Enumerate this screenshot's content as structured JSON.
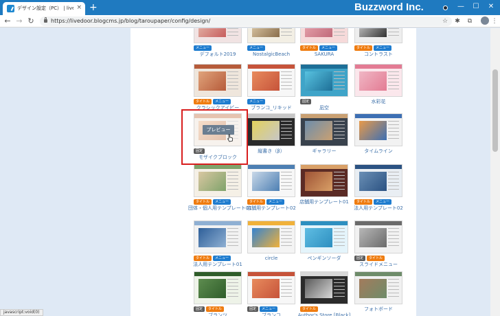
{
  "browser": {
    "tab_title": "デザイン設定（PC） | livedoor Blog",
    "tab_close": "×",
    "new_tab": "+",
    "brand": "Buzzword Inc.",
    "url": "https://livedoor.blogcms.jp/blog/taroupaper/config/design/",
    "status": "javascript:void(0)"
  },
  "icons": {
    "back": "←",
    "forward": "→",
    "reload": "↻",
    "star": "☆",
    "extension": "✱",
    "puzzle": "⧉",
    "menu": "⋮",
    "minimize": "—",
    "maximize": "☐",
    "close": "✕"
  },
  "badges": {
    "menu": "メニュー",
    "title": "タイトル",
    "fixed": "固定"
  },
  "preview_label": "プレビュー",
  "themes": [
    {
      "name": "デフォルト2019",
      "badges": [
        "menu"
      ],
      "colors": [
        "#f1e3e3",
        "#e7bfb0",
        "#c75d5d"
      ]
    },
    {
      "name": "NostalgicBeach",
      "badges": [
        "menu"
      ],
      "colors": [
        "#f3efe4",
        "#e6d3b0",
        "#8a6e4c"
      ]
    },
    {
      "name": "SAKURA",
      "badges": [
        "title",
        "menu"
      ],
      "colors": [
        "#f6dada",
        "#eba9b2",
        "#c06a7a"
      ]
    },
    {
      "name": "コントラスト",
      "badges": [
        "title",
        "menu"
      ],
      "colors": [
        "#eeeeee",
        "#d7d7d7",
        "#333333"
      ]
    },
    {
      "name": "クラシックアイビー",
      "badges": [
        "title",
        "menu"
      ],
      "colors": [
        "#efe6dc",
        "#e0a37b",
        "#b65b3a"
      ]
    },
    {
      "name": "ブランコ_リキッド",
      "badges": [
        "menu"
      ],
      "colors": [
        "#f7f7f7",
        "#e88b5d",
        "#c6533a"
      ]
    },
    {
      "name": "凪空",
      "badges": [
        "fixed"
      ],
      "colors": [
        "#3fa4c8",
        "#58c2e0",
        "#1d6f97"
      ]
    },
    {
      "name": "水彩花",
      "badges": [],
      "colors": [
        "#fbe7ec",
        "#f0b7c5",
        "#e37b93"
      ]
    },
    {
      "name": "モザイクブロック",
      "badges": [
        "fixed"
      ],
      "colors": [
        "#eee2d7",
        "#e8b489",
        "#c77b4e"
      ]
    },
    {
      "name": "縦書き（β）",
      "badges": [],
      "colors": [
        "#2a2a2a",
        "#e3d25c",
        "#c7c7c7"
      ]
    },
    {
      "name": "ギャラリー",
      "badges": [],
      "colors": [
        "#39424d",
        "#6d8eac",
        "#c9a072"
      ]
    },
    {
      "name": "タイムライン",
      "badges": [],
      "colors": [
        "#f2f2f2",
        "#e89a4a",
        "#3d6fb3"
      ]
    },
    {
      "name": "団体・個人用テンプレート01",
      "badges": [
        "title",
        "menu"
      ],
      "colors": [
        "#f5f0e6",
        "#d9c7a1",
        "#7fa36b"
      ]
    },
    {
      "name": "店舗用テンプレート02",
      "badges": [
        "title",
        "menu"
      ],
      "colors": [
        "#f7f7f7",
        "#c9d8e8",
        "#4d7fb3"
      ]
    },
    {
      "name": "店舗用テンプレート01",
      "badges": [],
      "colors": [
        "#5b2b25",
        "#9e5335",
        "#d9a067"
      ]
    },
    {
      "name": "法人用テンプレート02",
      "badges": [
        "title",
        "menu"
      ],
      "colors": [
        "#e9eef3",
        "#6a8fb5",
        "#2b5282"
      ]
    },
    {
      "name": "法人用テンプレート01",
      "badges": [
        "title",
        "menu"
      ],
      "colors": [
        "#f2f2f2",
        "#2e5f99",
        "#8fb0d3"
      ]
    },
    {
      "name": "circle",
      "badges": [],
      "colors": [
        "#f4f4f4",
        "#3583d0",
        "#f0b13a"
      ]
    },
    {
      "name": "ペンギンソーダ",
      "badges": [],
      "colors": [
        "#e4f4fb",
        "#5fbde3",
        "#2d8fc0"
      ]
    },
    {
      "name": "スライドメニュー",
      "badges": [
        "fixed",
        "title"
      ],
      "colors": [
        "#f2f2f2",
        "#b7b7b7",
        "#6b6b6b"
      ]
    },
    {
      "name": "ブランツ",
      "badges": [
        "fixed",
        "title"
      ],
      "colors": [
        "#eef3e8",
        "#5d8c4f",
        "#2f5d2a"
      ]
    },
    {
      "name": "ブランコ",
      "badges": [
        "fixed",
        "menu"
      ],
      "colors": [
        "#f7f7f7",
        "#e88b5d",
        "#c6533a"
      ]
    },
    {
      "name": "Author's Store [Black]",
      "badges": [
        "title"
      ],
      "colors": [
        "#2b2b2b",
        "#5a5a5a",
        "#d8d8d8"
      ]
    },
    {
      "name": "フォトボード",
      "badges": [],
      "colors": [
        "#f1f1f1",
        "#a37b5c",
        "#6e8c6a"
      ]
    }
  ]
}
